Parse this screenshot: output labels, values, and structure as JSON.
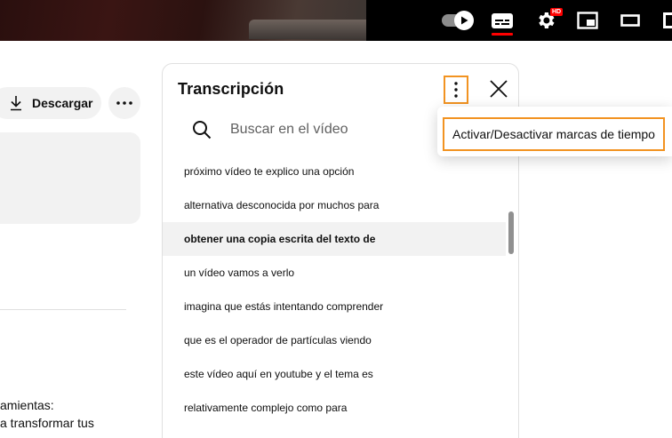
{
  "player": {
    "icons": [
      "autoplay-toggle-icon",
      "subtitles-icon",
      "settings-gear-icon",
      "miniplayer-icon",
      "theater-mode-icon",
      "fullscreen-icon"
    ],
    "hd_badge": "HD",
    "accent_color": "#ff0000"
  },
  "actions": {
    "download_label": "Descargar",
    "more_icon": "more-horizontal-icon"
  },
  "description": {
    "line1": "amientas:",
    "line2": "a transformar tus"
  },
  "transcript": {
    "title": "Transcripción",
    "search_placeholder": "Buscar en el vídeo",
    "highlight_color": "#f29321",
    "segments": [
      {
        "text": "próximo vídeo te explico una opción",
        "active": false
      },
      {
        "text": "alternativa desconocida por muchos para",
        "active": false
      },
      {
        "text": "obtener una copia escrita del texto de",
        "active": true
      },
      {
        "text": "un vídeo vamos a verlo",
        "active": false
      },
      {
        "text": "imagina que estás intentando comprender",
        "active": false
      },
      {
        "text": "que es el operador de partículas viendo",
        "active": false
      },
      {
        "text": "este vídeo aquí en youtube y el tema es",
        "active": false
      },
      {
        "text": "relativamente complejo como para",
        "active": false
      }
    ]
  },
  "menu": {
    "toggle_timestamps_label": "Activar/Desactivar marcas de tiempo"
  }
}
